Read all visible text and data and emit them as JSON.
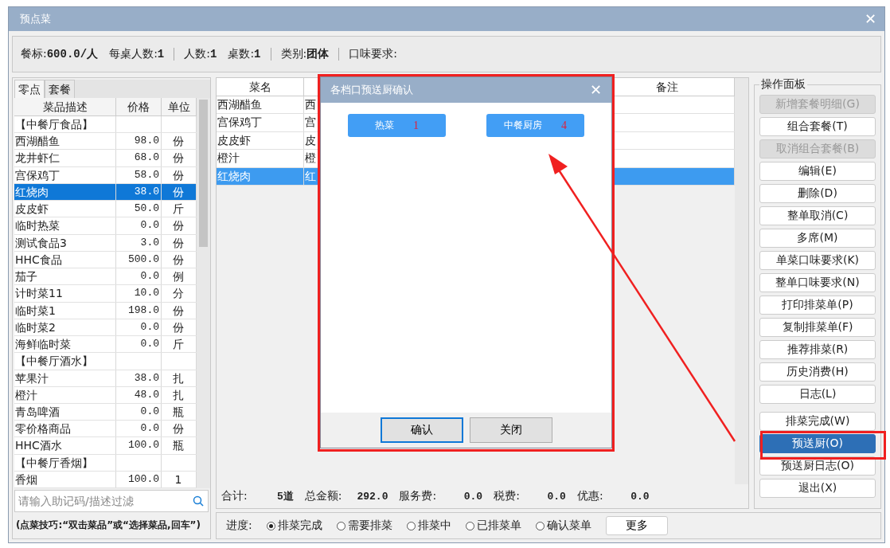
{
  "window": {
    "title": "预点菜",
    "close": "✕"
  },
  "info": {
    "groups": [
      [
        {
          "label": "餐标:",
          "value": "600.0/人"
        },
        {
          "label": "每桌人数:",
          "value": "1"
        }
      ],
      [
        {
          "label": "人数:",
          "value": "1"
        },
        {
          "label": "桌数:",
          "value": "1"
        }
      ],
      [
        {
          "label": "类别:",
          "value": "团体"
        }
      ],
      [
        {
          "label": "口味要求:"
        }
      ]
    ]
  },
  "menu": {
    "tabs": [
      {
        "label": "零点",
        "selected": true
      },
      {
        "label": "套餐",
        "selected": false
      }
    ],
    "columns": [
      "菜品描述",
      "价格",
      "单位"
    ],
    "rows": [
      {
        "kind": "category",
        "name": "【中餐厅食品】",
        "selected": false
      },
      {
        "kind": "item",
        "name": "西湖醋鱼",
        "price": "98.0",
        "unit": "份",
        "selected": false
      },
      {
        "kind": "item",
        "name": "龙井虾仁",
        "price": "68.0",
        "unit": "份",
        "selected": false
      },
      {
        "kind": "item",
        "name": "宫保鸡丁",
        "price": "58.0",
        "unit": "份",
        "selected": false
      },
      {
        "kind": "item",
        "name": "红烧肉",
        "price": "38.0",
        "unit": "份",
        "selected": true
      },
      {
        "kind": "item",
        "name": "皮皮虾",
        "price": "50.0",
        "unit": "斤",
        "selected": false
      },
      {
        "kind": "item",
        "name": "临时热菜",
        "price": "0.0",
        "unit": "份",
        "selected": false
      },
      {
        "kind": "item",
        "name": "测试食品3",
        "price": "3.0",
        "unit": "份",
        "selected": false
      },
      {
        "kind": "item",
        "name": "HHC食品",
        "price": "500.0",
        "unit": "份",
        "selected": false
      },
      {
        "kind": "item",
        "name": "茄子",
        "price": "0.0",
        "unit": "例",
        "selected": false
      },
      {
        "kind": "item",
        "name": "计时菜11",
        "price": "10.0",
        "unit": "分",
        "selected": false
      },
      {
        "kind": "item",
        "name": "临时菜1",
        "price": "198.0",
        "unit": "份",
        "selected": false
      },
      {
        "kind": "item",
        "name": "临时菜2",
        "price": "0.0",
        "unit": "份",
        "selected": false
      },
      {
        "kind": "item",
        "name": "海鲜临时菜",
        "price": "0.0",
        "unit": "斤",
        "selected": false
      },
      {
        "kind": "category",
        "name": "【中餐厅酒水】",
        "selected": false
      },
      {
        "kind": "item",
        "name": "苹果汁",
        "price": "38.0",
        "unit": "扎",
        "selected": false
      },
      {
        "kind": "item",
        "name": "橙汁",
        "price": "48.0",
        "unit": "扎",
        "selected": false
      },
      {
        "kind": "item",
        "name": "青岛啤酒",
        "price": "0.0",
        "unit": "瓶",
        "selected": false
      },
      {
        "kind": "item",
        "name": "零价格商品",
        "price": "0.0",
        "unit": "份",
        "selected": false
      },
      {
        "kind": "item",
        "name": "HHC酒水",
        "price": "100.0",
        "unit": "瓶",
        "selected": false
      },
      {
        "kind": "category",
        "name": "【中餐厅香烟】",
        "selected": false
      },
      {
        "kind": "item",
        "name": "香烟",
        "price": "100.0",
        "unit": "1",
        "selected": false
      }
    ],
    "search": {
      "placeholder": "请输入助记码/描述过滤"
    },
    "tip": "(点菜技巧:“双击菜品”或“选择菜品,回车”)"
  },
  "order": {
    "columns": [
      "菜名",
      "备注"
    ],
    "rows": [
      {
        "name": "西湖醋鱼",
        "column_2": "西",
        "selected": false
      },
      {
        "name": "宫保鸡丁",
        "column_2": "宫",
        "selected": false
      },
      {
        "name": "皮皮虾",
        "column_2": "皮",
        "selected": false
      },
      {
        "name": "橙汁",
        "column_2": "橙",
        "selected": false
      },
      {
        "name": "红烧肉",
        "column_2": "红",
        "selected": true
      }
    ],
    "totals": [
      {
        "label": "合计:",
        "value": "5道"
      },
      {
        "label": "总金额:",
        "value": "292.0"
      },
      {
        "label": "服务费:",
        "value": "0.0"
      },
      {
        "label": "税费:",
        "value": "0.0"
      },
      {
        "label": "优惠:",
        "value": "0.0"
      }
    ]
  },
  "progress": {
    "label": "进度:",
    "options": [
      {
        "label": "排菜完成",
        "selected": true
      },
      {
        "label": "需要排菜",
        "selected": false
      },
      {
        "label": "排菜中",
        "selected": false
      },
      {
        "label": "已排菜单",
        "selected": false
      },
      {
        "label": "确认菜单",
        "selected": false
      }
    ],
    "more": "更多"
  },
  "panel": {
    "title": "操作面板",
    "buttons": [
      {
        "label": "新增套餐明细(G)",
        "disabled": true,
        "selected": false
      },
      {
        "label": "组合套餐(T)",
        "disabled": false,
        "selected": false
      },
      {
        "label": "取消组合套餐(B)",
        "disabled": true,
        "selected": false
      },
      {
        "label": "编辑(E)",
        "disabled": false,
        "selected": false
      },
      {
        "label": "删除(D)",
        "disabled": false,
        "selected": false
      },
      {
        "label": "整单取消(C)",
        "disabled": false,
        "selected": false
      },
      {
        "label": "多席(M)",
        "disabled": false,
        "selected": false
      },
      {
        "label": "单菜口味要求(K)",
        "disabled": false,
        "selected": false
      },
      {
        "label": "整单口味要求(N)",
        "disabled": false,
        "selected": false
      },
      {
        "label": "打印排菜单(P)",
        "disabled": false,
        "selected": false
      },
      {
        "label": "复制排菜单(F)",
        "disabled": false,
        "selected": false
      },
      {
        "label": "推荐排菜(R)",
        "disabled": false,
        "selected": false
      },
      {
        "label": "历史消费(H)",
        "disabled": false,
        "selected": false
      },
      {
        "label": "日志(L)",
        "disabled": false,
        "selected": false
      },
      {
        "label": "排菜完成(W)",
        "disabled": false,
        "selected": false
      },
      {
        "label": "预送厨(O)",
        "disabled": false,
        "selected": true
      },
      {
        "label": "预送厨日志(O)",
        "disabled": false,
        "selected": false
      },
      {
        "label": "退出(X)",
        "disabled": false,
        "selected": false
      }
    ]
  },
  "dialog": {
    "title": "各档口预送厨确认",
    "close": "✕",
    "stations": [
      {
        "name": "热菜",
        "count": "1"
      },
      {
        "name": "中餐厨房",
        "count": "4"
      }
    ],
    "buttons": [
      {
        "label": "确认",
        "focused": true
      },
      {
        "label": "关闭",
        "focused": false
      }
    ]
  }
}
